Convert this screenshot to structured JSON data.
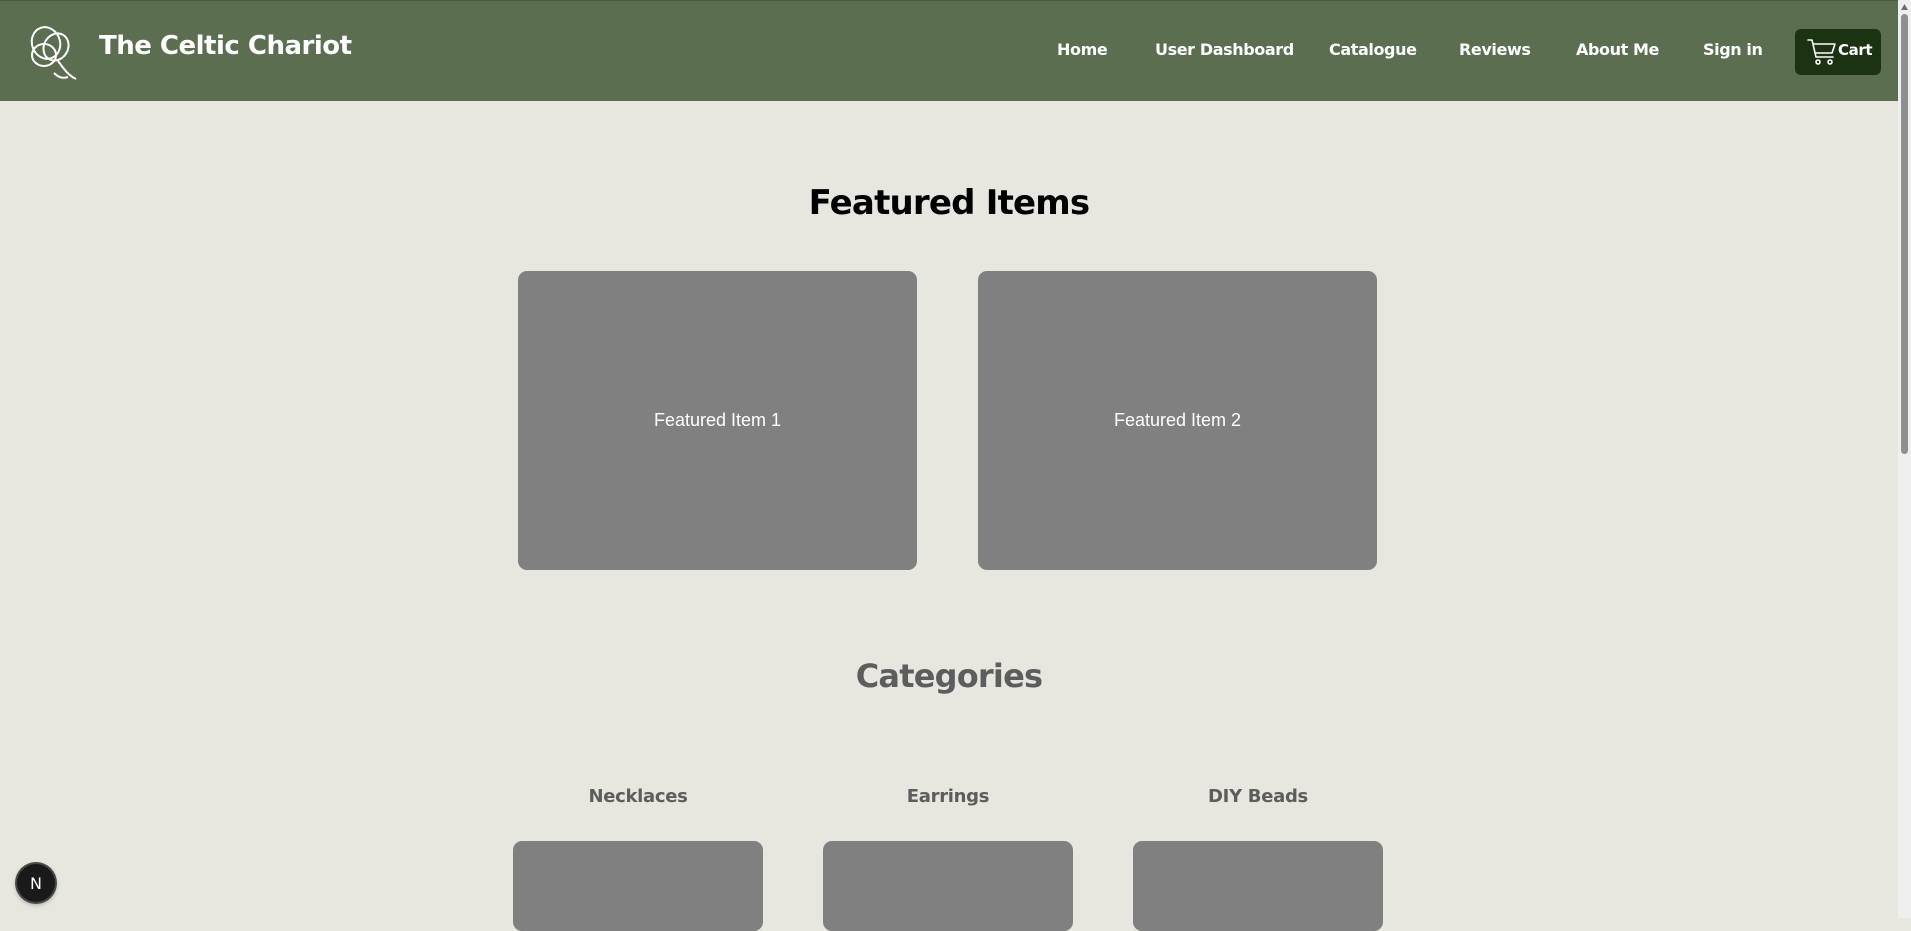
{
  "header": {
    "brand": "The Celtic Chariot",
    "logo_icon": "celtic-knot-icon",
    "nav": [
      {
        "label": "Home"
      },
      {
        "label": "User Dashboard"
      },
      {
        "label": "Catalogue"
      },
      {
        "label": "Reviews"
      },
      {
        "label": "About Me"
      },
      {
        "label": "Sign in"
      }
    ],
    "cart": {
      "label": "Cart",
      "icon": "shopping-cart-icon"
    }
  },
  "featured": {
    "title": "Featured Items",
    "items": [
      {
        "label": "Featured Item 1"
      },
      {
        "label": "Featured Item 2"
      }
    ]
  },
  "categories": {
    "title": "Categories",
    "items": [
      {
        "label": "Necklaces"
      },
      {
        "label": "Earrings"
      },
      {
        "label": "DIY Beads"
      }
    ]
  },
  "dev_badge": {
    "label": "N"
  },
  "colors": {
    "header_bg": "#5b6e50",
    "page_bg": "#e8e7df",
    "cart_bg": "#1c3311",
    "card_bg": "#808080"
  }
}
